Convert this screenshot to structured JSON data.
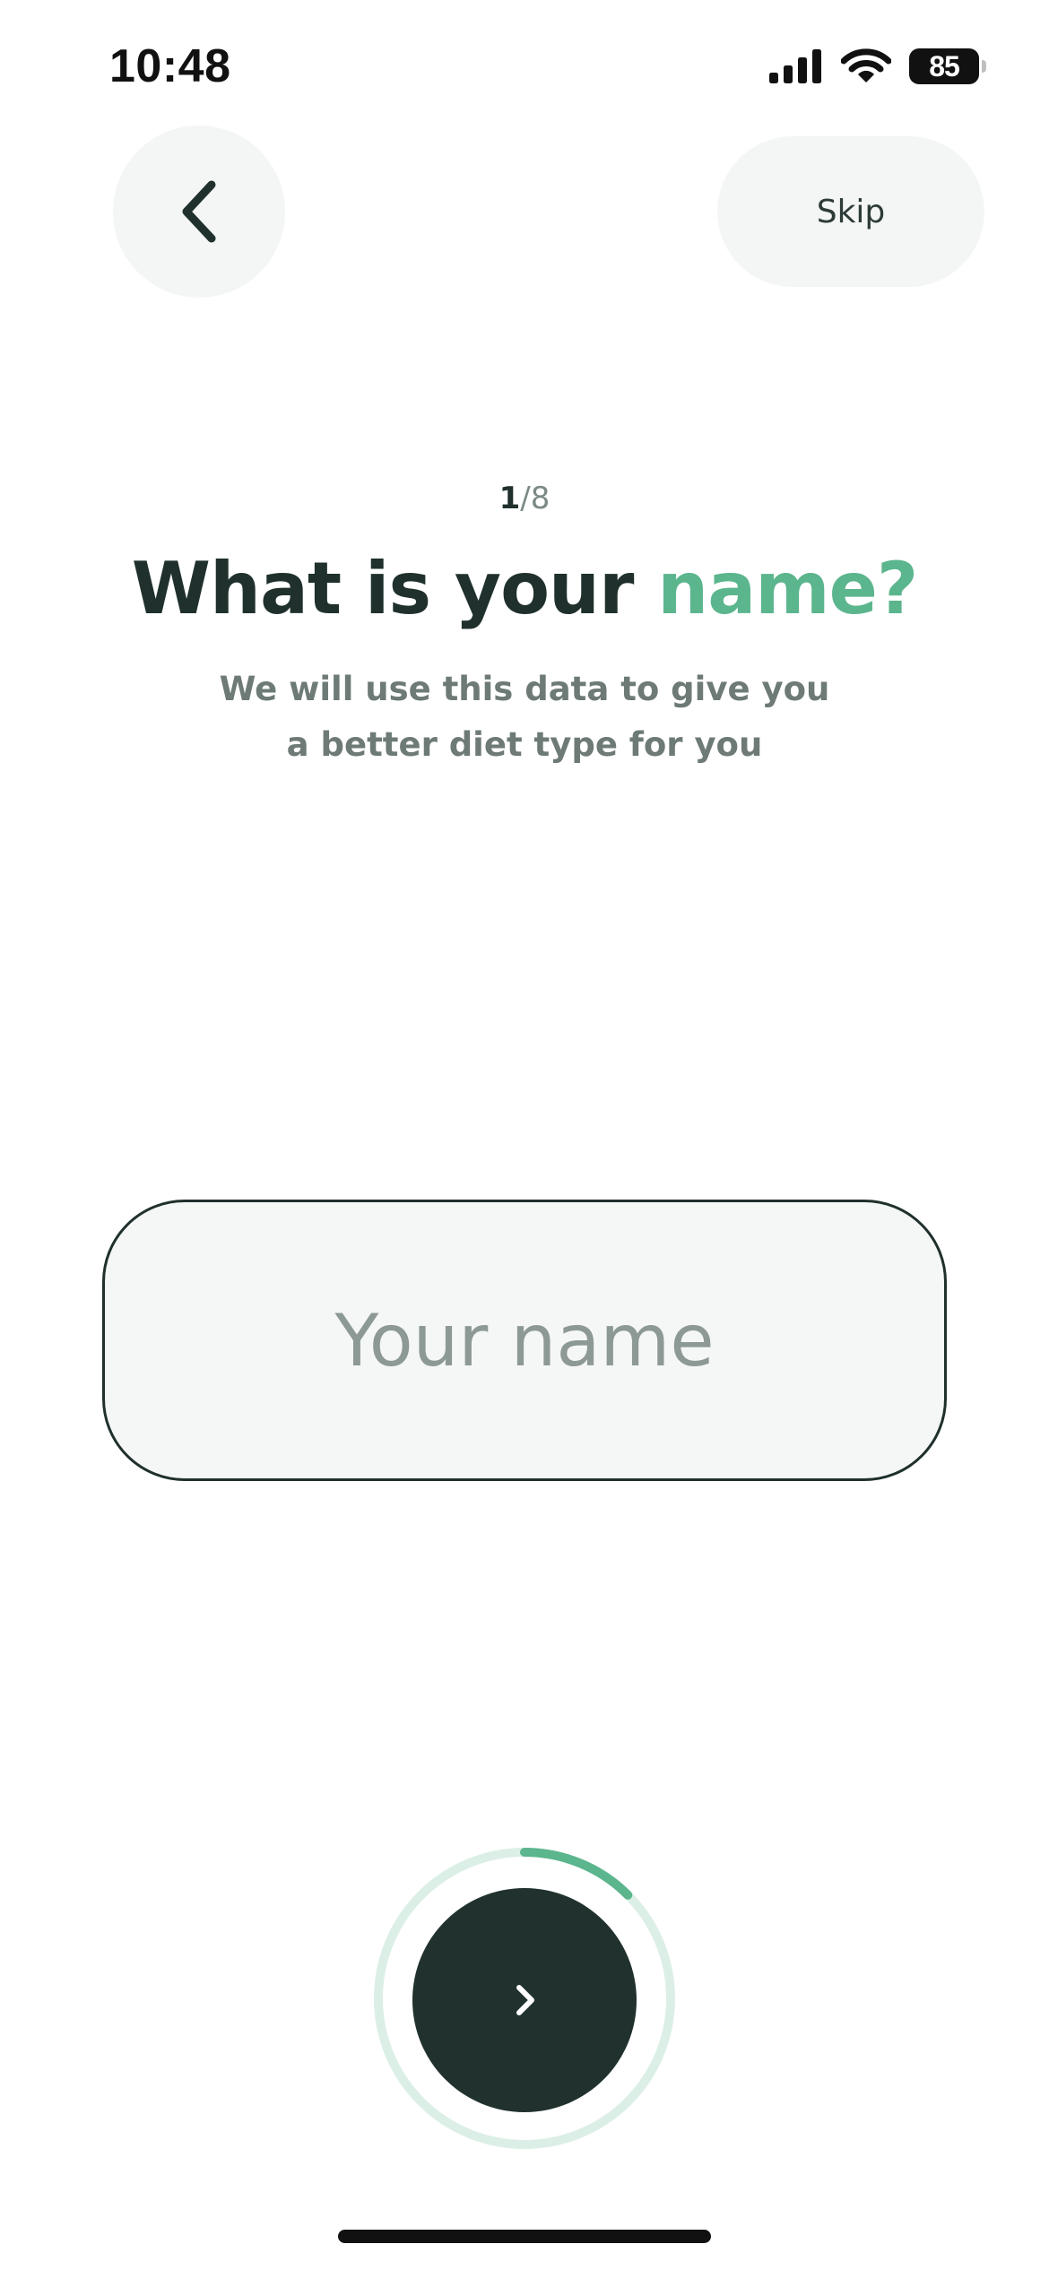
{
  "status_bar": {
    "time": "10:48",
    "battery_level": "85",
    "icons": [
      "cellular-signal-icon",
      "wifi-icon",
      "battery-icon"
    ]
  },
  "header": {
    "back_icon": "chevron-left-icon",
    "skip_label": "Skip"
  },
  "step": {
    "current": "1",
    "separator": "/",
    "total": "8"
  },
  "title": {
    "main": "What is your ",
    "accent": "name?"
  },
  "subtitle": "We will use this data to give you a better diet type for you",
  "name_input": {
    "value": "",
    "placeholder": "Your name"
  },
  "next_button": {
    "icon": "chevron-right-icon",
    "progress_fraction": 0.125
  },
  "colors": {
    "primary_dark": "#20312e",
    "accent_green": "#5bb58d",
    "ring_track": "#dcefe7",
    "surface": "#f4f6f5",
    "muted_text": "#6d7a76"
  }
}
